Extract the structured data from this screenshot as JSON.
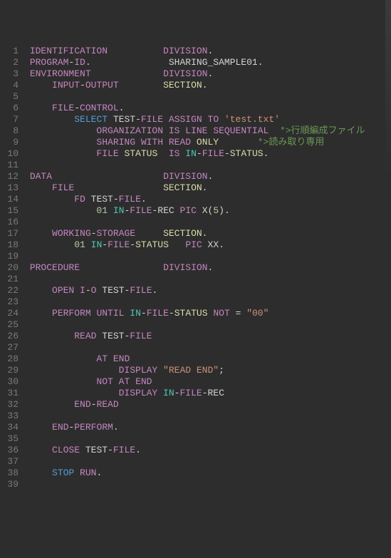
{
  "lines": [
    {
      "n": 1,
      "i": 1,
      "tokens": [
        [
          "kw",
          "IDENTIFICATION"
        ],
        [
          "wht",
          "          "
        ],
        [
          "kw",
          "DIVISION"
        ],
        [
          "op",
          "."
        ]
      ]
    },
    {
      "n": 2,
      "i": 1,
      "tokens": [
        [
          "kw",
          "PROGRAM"
        ],
        [
          "op",
          "-"
        ],
        [
          "kw",
          "ID"
        ],
        [
          "op",
          "."
        ],
        [
          "wht",
          "              "
        ],
        [
          "id",
          "SHARING_SAMPLE01"
        ],
        [
          "op",
          "."
        ]
      ]
    },
    {
      "n": 3,
      "i": 1,
      "tokens": [
        [
          "kw",
          "ENVIRONMENT"
        ],
        [
          "wht",
          "             "
        ],
        [
          "kw",
          "DIVISION"
        ],
        [
          "op",
          "."
        ]
      ]
    },
    {
      "n": 4,
      "i": 5,
      "tokens": [
        [
          "kw",
          "INPUT"
        ],
        [
          "op",
          "-"
        ],
        [
          "kw",
          "OUTPUT"
        ],
        [
          "wht",
          "        "
        ],
        [
          "sec",
          "SECTION"
        ],
        [
          "op",
          "."
        ]
      ]
    },
    {
      "n": 5,
      "i": 0,
      "tokens": []
    },
    {
      "n": 6,
      "i": 5,
      "tokens": [
        [
          "kw",
          "FILE"
        ],
        [
          "op",
          "-"
        ],
        [
          "kw",
          "CONTROL"
        ],
        [
          "op",
          "."
        ]
      ]
    },
    {
      "n": 7,
      "i": 9,
      "tokens": [
        [
          "blue",
          "SELECT"
        ],
        [
          "wht",
          " "
        ],
        [
          "id",
          "TEST"
        ],
        [
          "op",
          "-"
        ],
        [
          "kw",
          "FILE"
        ],
        [
          "wht",
          " "
        ],
        [
          "kw",
          "ASSIGN"
        ],
        [
          "wht",
          " "
        ],
        [
          "kw",
          "TO"
        ],
        [
          "wht",
          " "
        ],
        [
          "str",
          "'test.txt'"
        ]
      ]
    },
    {
      "n": 8,
      "i": 13,
      "tokens": [
        [
          "kw",
          "ORGANIZATION"
        ],
        [
          "wht",
          " "
        ],
        [
          "kw",
          "IS"
        ],
        [
          "wht",
          " "
        ],
        [
          "kw",
          "LINE"
        ],
        [
          "wht",
          " "
        ],
        [
          "kw",
          "SEQUENTIAL"
        ],
        [
          "wht",
          "  "
        ],
        [
          "cmt",
          "*>行順編成ファイル"
        ]
      ]
    },
    {
      "n": 9,
      "i": 13,
      "tokens": [
        [
          "kw",
          "SHARING"
        ],
        [
          "wht",
          " "
        ],
        [
          "kw",
          "WITH"
        ],
        [
          "wht",
          " "
        ],
        [
          "kw",
          "READ"
        ],
        [
          "wht",
          " "
        ],
        [
          "sec",
          "ONLY"
        ],
        [
          "wht",
          "       "
        ],
        [
          "cmt",
          "*>読み取り専用"
        ]
      ]
    },
    {
      "n": 10,
      "i": 13,
      "tokens": [
        [
          "kw",
          "FILE"
        ],
        [
          "wht",
          " "
        ],
        [
          "sec",
          "STATUS"
        ],
        [
          "wht",
          "  "
        ],
        [
          "kw",
          "IS"
        ],
        [
          "wht",
          " "
        ],
        [
          "cyan",
          "IN"
        ],
        [
          "op",
          "-"
        ],
        [
          "kw",
          "FILE"
        ],
        [
          "op",
          "-"
        ],
        [
          "sec",
          "STATUS"
        ],
        [
          "op",
          "."
        ]
      ]
    },
    {
      "n": 11,
      "i": 0,
      "tokens": []
    },
    {
      "n": 12,
      "i": 1,
      "tokens": [
        [
          "kw",
          "DATA"
        ],
        [
          "wht",
          "                    "
        ],
        [
          "kw",
          "DIVISION"
        ],
        [
          "op",
          "."
        ]
      ]
    },
    {
      "n": 13,
      "i": 5,
      "tokens": [
        [
          "kw",
          "FILE"
        ],
        [
          "wht",
          "                "
        ],
        [
          "sec",
          "SECTION"
        ],
        [
          "op",
          "."
        ]
      ]
    },
    {
      "n": 14,
      "i": 9,
      "tokens": [
        [
          "kw",
          "FD"
        ],
        [
          "wht",
          " "
        ],
        [
          "id",
          "TEST"
        ],
        [
          "op",
          "-"
        ],
        [
          "kw",
          "FILE"
        ],
        [
          "op",
          "."
        ]
      ]
    },
    {
      "n": 15,
      "i": 13,
      "tokens": [
        [
          "num",
          "01"
        ],
        [
          "wht",
          " "
        ],
        [
          "cyan",
          "IN"
        ],
        [
          "op",
          "-"
        ],
        [
          "kw",
          "FILE"
        ],
        [
          "op",
          "-"
        ],
        [
          "id",
          "REC"
        ],
        [
          "wht",
          " "
        ],
        [
          "kw",
          "PIC"
        ],
        [
          "wht",
          " "
        ],
        [
          "id",
          "X"
        ],
        [
          "op",
          "("
        ],
        [
          "num",
          "5"
        ],
        [
          "op",
          ")"
        ],
        [
          "op",
          "."
        ]
      ]
    },
    {
      "n": 16,
      "i": 0,
      "tokens": []
    },
    {
      "n": 17,
      "i": 5,
      "tokens": [
        [
          "kw",
          "WORKING"
        ],
        [
          "op",
          "-"
        ],
        [
          "kw",
          "STORAGE"
        ],
        [
          "wht",
          "     "
        ],
        [
          "sec",
          "SECTION"
        ],
        [
          "op",
          "."
        ]
      ]
    },
    {
      "n": 18,
      "i": 9,
      "tokens": [
        [
          "num",
          "01"
        ],
        [
          "wht",
          " "
        ],
        [
          "cyan",
          "IN"
        ],
        [
          "op",
          "-"
        ],
        [
          "kw",
          "FILE"
        ],
        [
          "op",
          "-"
        ],
        [
          "sec",
          "STATUS"
        ],
        [
          "wht",
          "   "
        ],
        [
          "kw",
          "PIC"
        ],
        [
          "wht",
          " "
        ],
        [
          "id",
          "XX"
        ],
        [
          "op",
          "."
        ]
      ]
    },
    {
      "n": 19,
      "i": 0,
      "tokens": []
    },
    {
      "n": 20,
      "i": 1,
      "tokens": [
        [
          "kw",
          "PROCEDURE"
        ],
        [
          "wht",
          "               "
        ],
        [
          "kw",
          "DIVISION"
        ],
        [
          "op",
          "."
        ]
      ]
    },
    {
      "n": 21,
      "i": 0,
      "tokens": []
    },
    {
      "n": 22,
      "i": 5,
      "tokens": [
        [
          "kw",
          "OPEN"
        ],
        [
          "wht",
          " "
        ],
        [
          "kw",
          "I"
        ],
        [
          "op",
          "-"
        ],
        [
          "kw",
          "O"
        ],
        [
          "wht",
          " "
        ],
        [
          "id",
          "TEST"
        ],
        [
          "op",
          "-"
        ],
        [
          "kw",
          "FILE"
        ],
        [
          "op",
          "."
        ]
      ]
    },
    {
      "n": 23,
      "i": 0,
      "tokens": []
    },
    {
      "n": 24,
      "i": 5,
      "tokens": [
        [
          "kw",
          "PERFORM"
        ],
        [
          "wht",
          " "
        ],
        [
          "kw",
          "UNTIL"
        ],
        [
          "wht",
          " "
        ],
        [
          "cyan",
          "IN"
        ],
        [
          "op",
          "-"
        ],
        [
          "kw",
          "FILE"
        ],
        [
          "op",
          "-"
        ],
        [
          "sec",
          "STATUS"
        ],
        [
          "wht",
          " "
        ],
        [
          "kw",
          "NOT"
        ],
        [
          "wht",
          " "
        ],
        [
          "op",
          "="
        ],
        [
          "wht",
          " "
        ],
        [
          "str",
          "\"00\""
        ]
      ]
    },
    {
      "n": 25,
      "i": 0,
      "tokens": []
    },
    {
      "n": 26,
      "i": 9,
      "tokens": [
        [
          "kw",
          "READ"
        ],
        [
          "wht",
          " "
        ],
        [
          "id",
          "TEST"
        ],
        [
          "op",
          "-"
        ],
        [
          "kw",
          "FILE"
        ]
      ]
    },
    {
      "n": 27,
      "i": 0,
      "tokens": []
    },
    {
      "n": 28,
      "i": 13,
      "tokens": [
        [
          "kw",
          "AT"
        ],
        [
          "wht",
          " "
        ],
        [
          "kw",
          "END"
        ]
      ]
    },
    {
      "n": 29,
      "i": 17,
      "tokens": [
        [
          "kw",
          "DISPLAY"
        ],
        [
          "wht",
          " "
        ],
        [
          "str",
          "\"READ END\""
        ],
        [
          "op",
          ";"
        ]
      ]
    },
    {
      "n": 30,
      "i": 13,
      "tokens": [
        [
          "kw",
          "NOT"
        ],
        [
          "wht",
          " "
        ],
        [
          "kw",
          "AT"
        ],
        [
          "wht",
          " "
        ],
        [
          "kw",
          "END"
        ]
      ]
    },
    {
      "n": 31,
      "i": 17,
      "tokens": [
        [
          "kw",
          "DISPLAY"
        ],
        [
          "wht",
          " "
        ],
        [
          "cyan",
          "IN"
        ],
        [
          "op",
          "-"
        ],
        [
          "kw",
          "FILE"
        ],
        [
          "op",
          "-"
        ],
        [
          "id",
          "REC"
        ]
      ]
    },
    {
      "n": 32,
      "i": 9,
      "tokens": [
        [
          "kw",
          "END"
        ],
        [
          "op",
          "-"
        ],
        [
          "kw",
          "READ"
        ]
      ]
    },
    {
      "n": 33,
      "i": 0,
      "tokens": []
    },
    {
      "n": 34,
      "i": 5,
      "tokens": [
        [
          "kw",
          "END"
        ],
        [
          "op",
          "-"
        ],
        [
          "kw",
          "PERFORM"
        ],
        [
          "op",
          "."
        ]
      ]
    },
    {
      "n": 35,
      "i": 0,
      "tokens": []
    },
    {
      "n": 36,
      "i": 5,
      "tokens": [
        [
          "kw",
          "CLOSE"
        ],
        [
          "wht",
          " "
        ],
        [
          "id",
          "TEST"
        ],
        [
          "op",
          "-"
        ],
        [
          "kw",
          "FILE"
        ],
        [
          "op",
          "."
        ]
      ]
    },
    {
      "n": 37,
      "i": 0,
      "tokens": []
    },
    {
      "n": 38,
      "i": 5,
      "tokens": [
        [
          "blue",
          "STOP"
        ],
        [
          "wht",
          " "
        ],
        [
          "kw",
          "RUN"
        ],
        [
          "op",
          "."
        ]
      ]
    },
    {
      "n": 39,
      "i": 0,
      "tokens": []
    }
  ]
}
